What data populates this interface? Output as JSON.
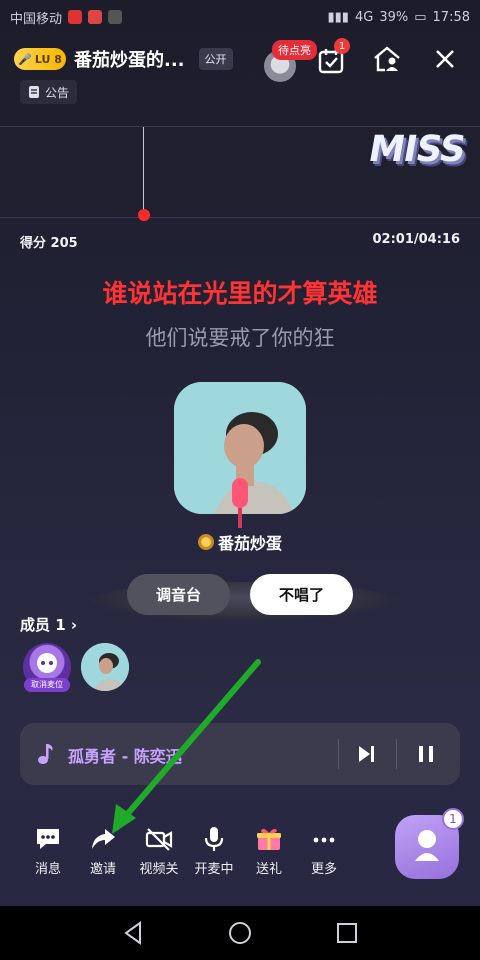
{
  "status_bar": {
    "carrier": "中国移动",
    "signal_text": "4G",
    "battery": "39%",
    "time": "17:58"
  },
  "header": {
    "level_badge": "LU 8",
    "room_title": "番茄炒蛋的...",
    "public_label": "公开",
    "pending_label": "待点亮",
    "task_count": "1",
    "notice_label": "公告"
  },
  "pitch": {
    "miss_label": "MISS"
  },
  "karaoke": {
    "score": "得分 205",
    "timer": "02:01/04:16",
    "lyric_current": "谁说站在光里的才算英雄",
    "lyric_next": "他们说要戒了你的狂",
    "singer_name": "番茄炒蛋",
    "mixer_label": "调音台",
    "stop_label": "不唱了"
  },
  "members": {
    "title": "成员 1",
    "member_tag": "取消麦位"
  },
  "player": {
    "song": "孤勇者 - 陈奕迅"
  },
  "toolbar": {
    "items": [
      {
        "label": "消息"
      },
      {
        "label": "邀请"
      },
      {
        "label": "视频关"
      },
      {
        "label": "开麦中"
      },
      {
        "label": "送礼"
      },
      {
        "label": "更多"
      }
    ],
    "float_badge": "1"
  },
  "colors": {
    "lyric_active": "#ff3333",
    "accent_purple": "#c8a2ff",
    "annotation_arrow": "#1faa2a"
  }
}
